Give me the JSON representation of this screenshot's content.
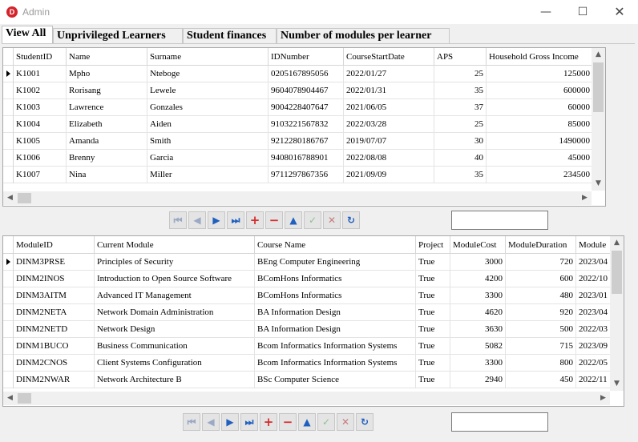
{
  "window": {
    "title": "Admin",
    "icon": "D",
    "controls": [
      "—",
      "☐",
      "✕"
    ]
  },
  "tabs": [
    "View All",
    "Unprivileged Learners",
    "Student finances",
    "Number of modules per learner"
  ],
  "grid1": {
    "columns": [
      "StudentID",
      "Name",
      "Surname",
      "IDNumber",
      "CourseStartDate",
      "APS",
      "Household Gross Income"
    ],
    "rows": [
      [
        "K1001",
        "Mpho",
        "Nteboge",
        "0205167895056",
        "2022/01/27",
        "25",
        "125000"
      ],
      [
        "K1002",
        "Rorisang",
        "Lewele",
        "9604078904467",
        "2022/01/31",
        "35",
        "600000"
      ],
      [
        "K1003",
        "Lawrence",
        "Gonzales",
        "9004228407647",
        "2021/06/05",
        "37",
        "60000"
      ],
      [
        "K1004",
        "Elizabeth",
        "Aiden",
        "9103221567832",
        "2022/03/28",
        "25",
        "85000"
      ],
      [
        "K1005",
        "Amanda",
        "Smith",
        "9212280186767",
        "2019/07/07",
        "30",
        "1490000"
      ],
      [
        "K1006",
        "Brenny",
        "Garcia",
        "9408016788901",
        "2022/08/08",
        "40",
        "45000"
      ],
      [
        "K1007",
        "Nina",
        "Miller",
        "9711297867356",
        "2021/09/09",
        "35",
        "234500"
      ]
    ]
  },
  "grid2": {
    "columns": [
      "ModuleID",
      "Current Module",
      "Course Name",
      "Project",
      "ModuleCost",
      "ModuleDuration",
      "Module"
    ],
    "rows": [
      [
        "DINM3PRSE",
        "Principles of Security",
        "BEng Computer Engineering",
        "True",
        "3000",
        "720",
        "2023/04"
      ],
      [
        "DINM2INOS",
        "Introduction to Open Source Software",
        "BComHons Informatics",
        "True",
        "4200",
        "600",
        "2022/10"
      ],
      [
        "DINM3AITM",
        "Advanced IT Management",
        "BComHons Informatics",
        "True",
        "3300",
        "480",
        "2023/01"
      ],
      [
        "DINM2NETA",
        "Network Domain Administration",
        "BA Information Design",
        "True",
        "4620",
        "920",
        "2023/04"
      ],
      [
        "DINM2NETD",
        "Network Design",
        "BA Information Design",
        "True",
        "3630",
        "500",
        "2022/03"
      ],
      [
        "DINM1BUCO",
        "Business Communication",
        "Bcom Informatics Information Systems",
        "True",
        "5082",
        "715",
        "2023/09"
      ],
      [
        "DINM2CNOS",
        "Client Systems Configuration",
        "Bcom Informatics Information Systems",
        "True",
        "3300",
        "800",
        "2022/05"
      ],
      [
        "DINM2NWAR",
        "Network Architecture B",
        "BSc Computer Science",
        "True",
        "2940",
        "450",
        "2022/11"
      ]
    ]
  },
  "navigator": {
    "icons": [
      "first-icon",
      "previous-icon",
      "next-icon",
      "last-icon",
      "add-icon",
      "delete-icon",
      "move-up-icon",
      "save-icon",
      "cancel-icon",
      "refresh-icon"
    ],
    "glyphs": [
      "⏮",
      "◀",
      "▶",
      "⏭",
      "+",
      "−",
      "▲",
      "✓",
      "✕",
      "↻"
    ]
  },
  "search1": {
    "value": ""
  },
  "search2": {
    "value": ""
  }
}
